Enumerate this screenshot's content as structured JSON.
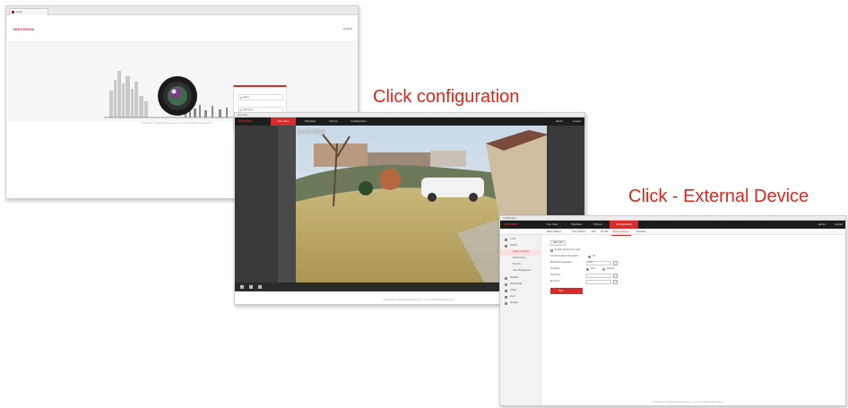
{
  "captions": {
    "step1": "Click configuration",
    "step2": "Click - External Device"
  },
  "login_screen": {
    "tab_title": "Login",
    "logo": "HIKVISION",
    "lang": "English",
    "user_placeholder": "admin",
    "password_placeholder": "Password",
    "forgot": "Forgot Password?",
    "login_button": "Login",
    "footer": "©Hikvision Digital Technology Co., Ltd. All Rights Reserved."
  },
  "liveview_screen": {
    "title": "Live View",
    "brand": "HIKVISION",
    "nav": [
      "Live View",
      "Playback",
      "Picture",
      "Configuration"
    ],
    "active_nav": "Live View",
    "user": "admin",
    "logout": "Logout",
    "osd": "04-26-2020",
    "footer": "©Hikvision Digital Technology Co., Ltd. All Rights Reserved."
  },
  "config_screen": {
    "title": "Configuration",
    "brand": "HIKVISION",
    "nav": [
      "Live View",
      "Playback",
      "Picture",
      "Configuration"
    ],
    "active_nav": "Configuration",
    "user": "admin",
    "logout": "Logout",
    "subtabs": [
      "Basic Settings",
      "Time Settings",
      "DST",
      "RS-485",
      "External Device",
      "Metadata"
    ],
    "active_subtab": "External Device",
    "sidebar": [
      {
        "label": "Local",
        "sub": false,
        "active": false
      },
      {
        "label": "System",
        "sub": false,
        "active": false
      },
      {
        "label": "System Settings",
        "sub": true,
        "active": true
      },
      {
        "label": "Maintenance",
        "sub": true,
        "active": false
      },
      {
        "label": "Security",
        "sub": true,
        "active": false
      },
      {
        "label": "User Management",
        "sub": true,
        "active": false
      },
      {
        "label": "Network",
        "sub": false,
        "active": false
      },
      {
        "label": "Video/Audio",
        "sub": false,
        "active": false
      },
      {
        "label": "Image",
        "sub": false,
        "active": false
      },
      {
        "label": "Event",
        "sub": false,
        "active": false
      },
      {
        "label": "Storage",
        "sub": false,
        "active": false
      }
    ],
    "section_label": "LED Light",
    "enable_label": "Enable Supplement Light",
    "mode_label": "Low Illumination Attenuation",
    "mode_value": "Off",
    "brightness_label": "Brightness Regulation",
    "brightness_value": "Auto",
    "schedule_label": "Schedule",
    "schedule_options": [
      "Auto",
      "Manual"
    ],
    "start_label": "Start Time",
    "end_label": "End Time",
    "save_button": "Save",
    "footer": "©Hikvision Digital Technology Co., Ltd. All Rights Reserved."
  },
  "colors": {
    "accent": "#d62b2b",
    "caption": "#e0241b",
    "navbar": "#1d1d1d"
  }
}
